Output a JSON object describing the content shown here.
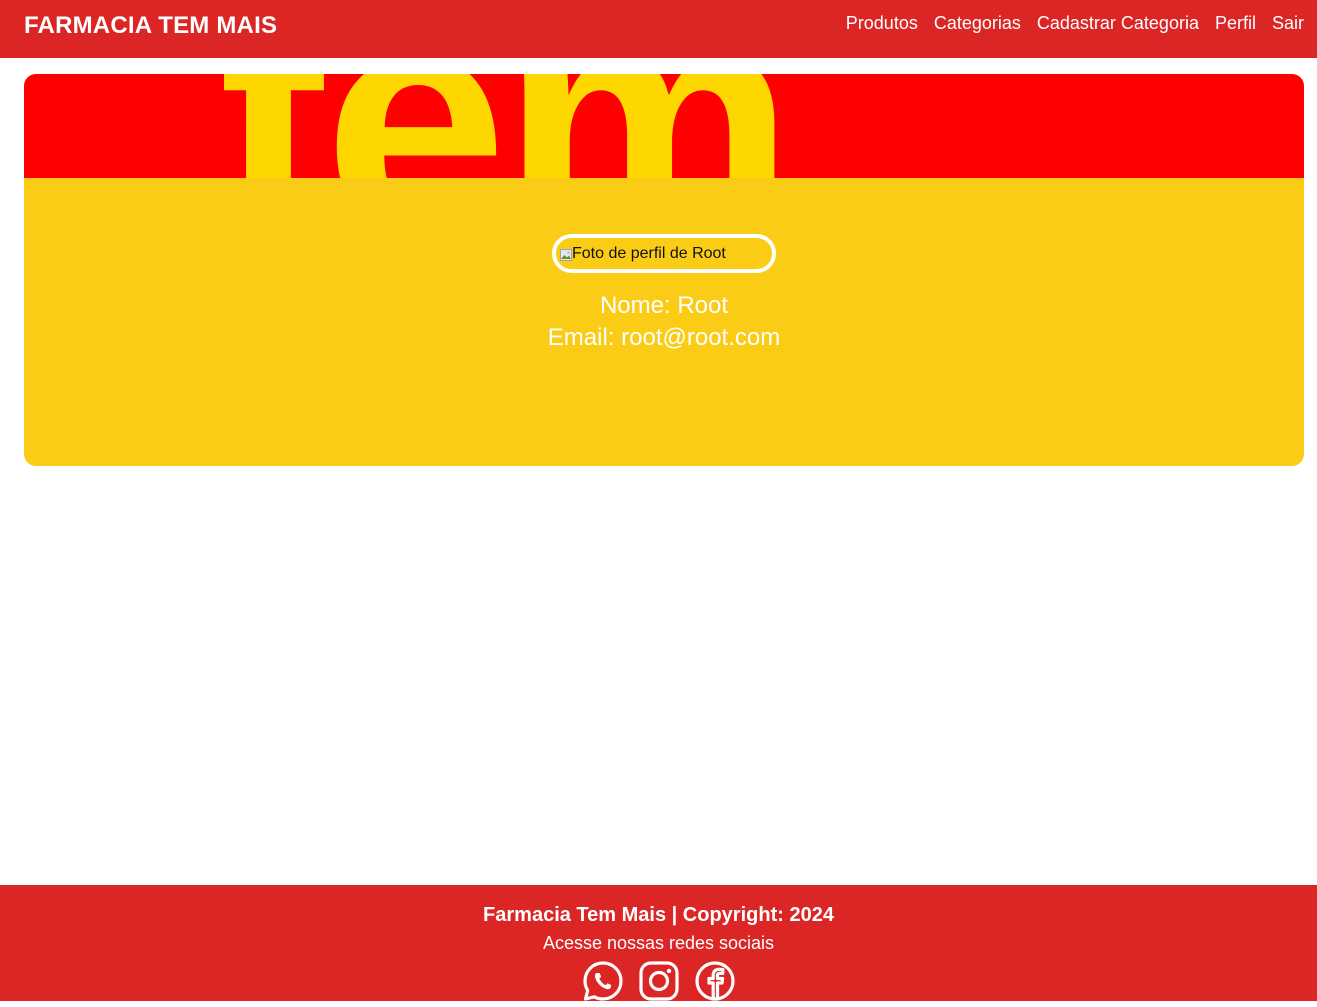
{
  "navbar": {
    "brand": "FARMACIA TEM MAIS",
    "links": [
      "Produtos",
      "Categorias",
      "Cadastrar Categoria",
      "Perfil",
      "Sair"
    ]
  },
  "banner": {
    "word": "tem"
  },
  "profile": {
    "photo_alt": "Foto de perfil de Root",
    "name_line": "Nome: Root",
    "email_line": "Email: root@root.com"
  },
  "footer": {
    "copyright": "Farmacia Tem Mais | Copyright: 2024",
    "social_text": "Acesse nossas redes sociais",
    "social_icons": [
      "whatsapp-icon",
      "instagram-icon",
      "facebook-icon"
    ]
  },
  "colors": {
    "primary_red": "#dc2626",
    "card_yellow": "#facc15",
    "banner_red": "#ff0000",
    "banner_yellow": "#ffd700"
  }
}
